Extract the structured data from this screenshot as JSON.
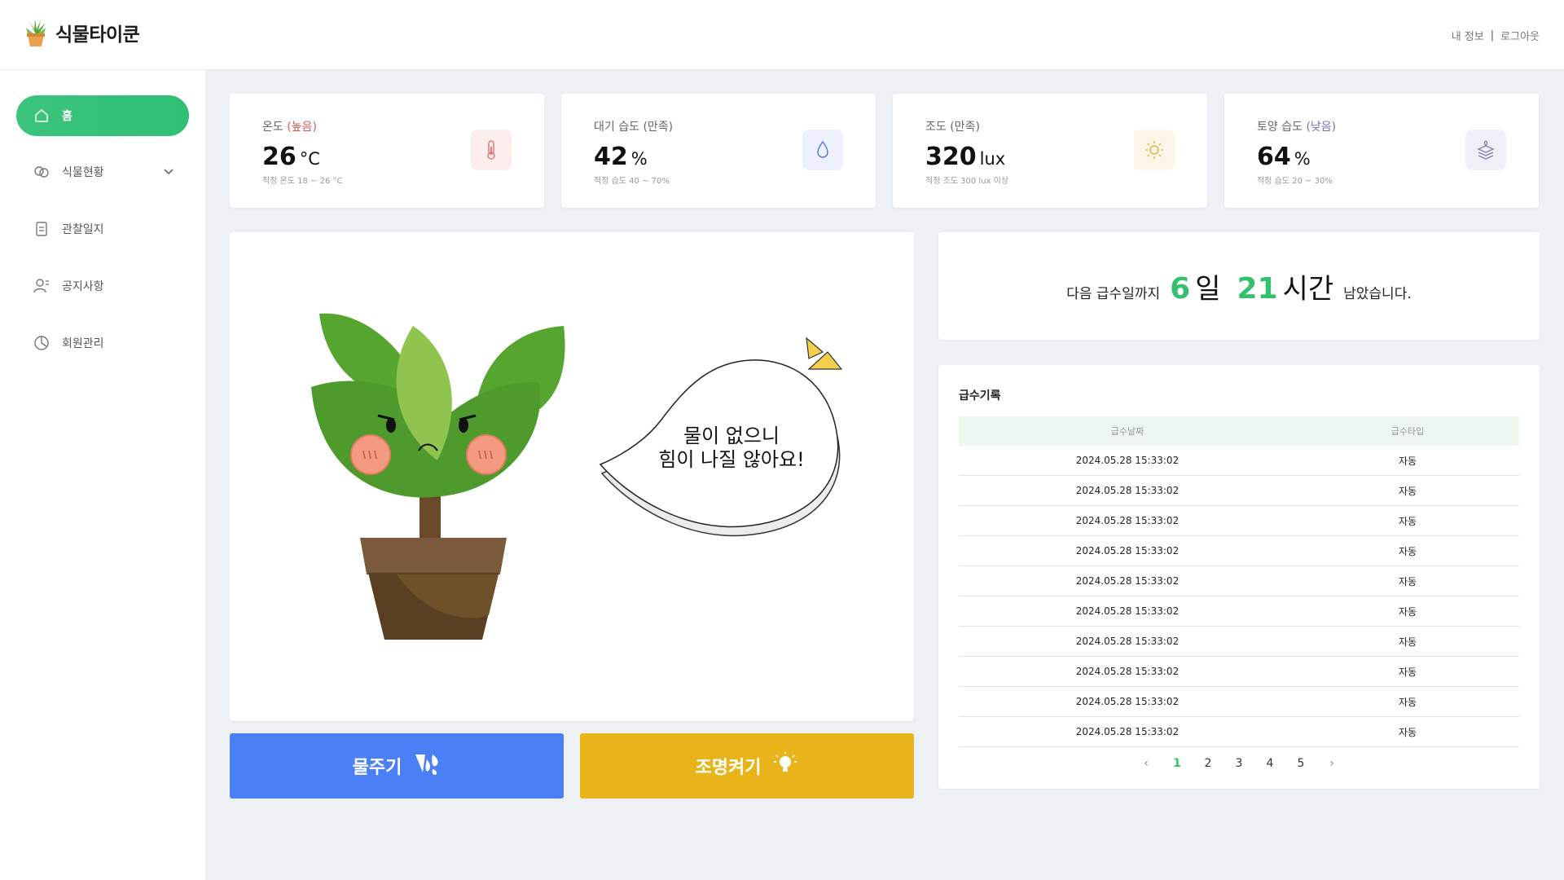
{
  "header": {
    "brand": "식물타이쿤",
    "my_info": "내 정보",
    "separator": "|",
    "logout": "로그아웃"
  },
  "sidebar": {
    "items": [
      {
        "label": "홈",
        "icon": "home-icon",
        "active": true
      },
      {
        "label": "식물현황",
        "icon": "plant-status-icon",
        "active": false
      },
      {
        "label": "관찰일지",
        "icon": "journal-icon",
        "active": false
      },
      {
        "label": "공지사항",
        "icon": "notice-icon",
        "active": false
      },
      {
        "label": "회원관리",
        "icon": "member-icon",
        "active": false
      }
    ]
  },
  "stats": [
    {
      "label": "온도",
      "status": "(높음)",
      "value": "26",
      "unit": "°C",
      "hint": "적정 온도 18 ~ 26 °C",
      "icon": "thermometer-icon"
    },
    {
      "label": "대기 습도",
      "status": "(만족)",
      "value": "42",
      "unit": "%",
      "hint": "적정 습도 40 ~ 70%",
      "icon": "water-drop-icon"
    },
    {
      "label": "조도",
      "status": "(만족)",
      "value": "320",
      "unit": "lux",
      "hint": "적정 조도 300 lux 이상",
      "icon": "sun-icon"
    },
    {
      "label": "토양 습도",
      "status": "(낮음)",
      "value": "64",
      "unit": "%",
      "hint": "적정 습도 20 ~ 30%",
      "icon": "soil-layers-icon"
    }
  ],
  "colors": {
    "accent": "#34c06f",
    "water_button": "#4a7ff6",
    "light_button": "#e8b41a",
    "status_high": "#d35a5a",
    "status_low": "#7e6fb2"
  },
  "plant": {
    "speech_line1": "물이 없으니",
    "speech_line2": "힘이 나질 않아요!"
  },
  "actions": {
    "water_label": "물주기",
    "light_label": "조명켜기"
  },
  "countdown": {
    "prefix": "다음 급수일까지",
    "days": "6",
    "days_unit": "일",
    "hours": "21",
    "hours_unit": "시간",
    "suffix": "남았습니다."
  },
  "history": {
    "title": "급수기록",
    "columns": [
      "급수날짜",
      "급수타입"
    ],
    "rows": [
      [
        "2024.05.28 15:33:02",
        "자동"
      ],
      [
        "2024.05.28 15:33:02",
        "자동"
      ],
      [
        "2024.05.28 15:33:02",
        "자동"
      ],
      [
        "2024.05.28 15:33:02",
        "자동"
      ],
      [
        "2024.05.28 15:33:02",
        "자동"
      ],
      [
        "2024.05.28 15:33:02",
        "자동"
      ],
      [
        "2024.05.28 15:33:02",
        "자동"
      ],
      [
        "2024.05.28 15:33:02",
        "자동"
      ],
      [
        "2024.05.28 15:33:02",
        "자동"
      ],
      [
        "2024.05.28 15:33:02",
        "자동"
      ]
    ],
    "pages": [
      "1",
      "2",
      "3",
      "4",
      "5"
    ],
    "current_page": "1",
    "prev": "‹",
    "next": "›"
  }
}
